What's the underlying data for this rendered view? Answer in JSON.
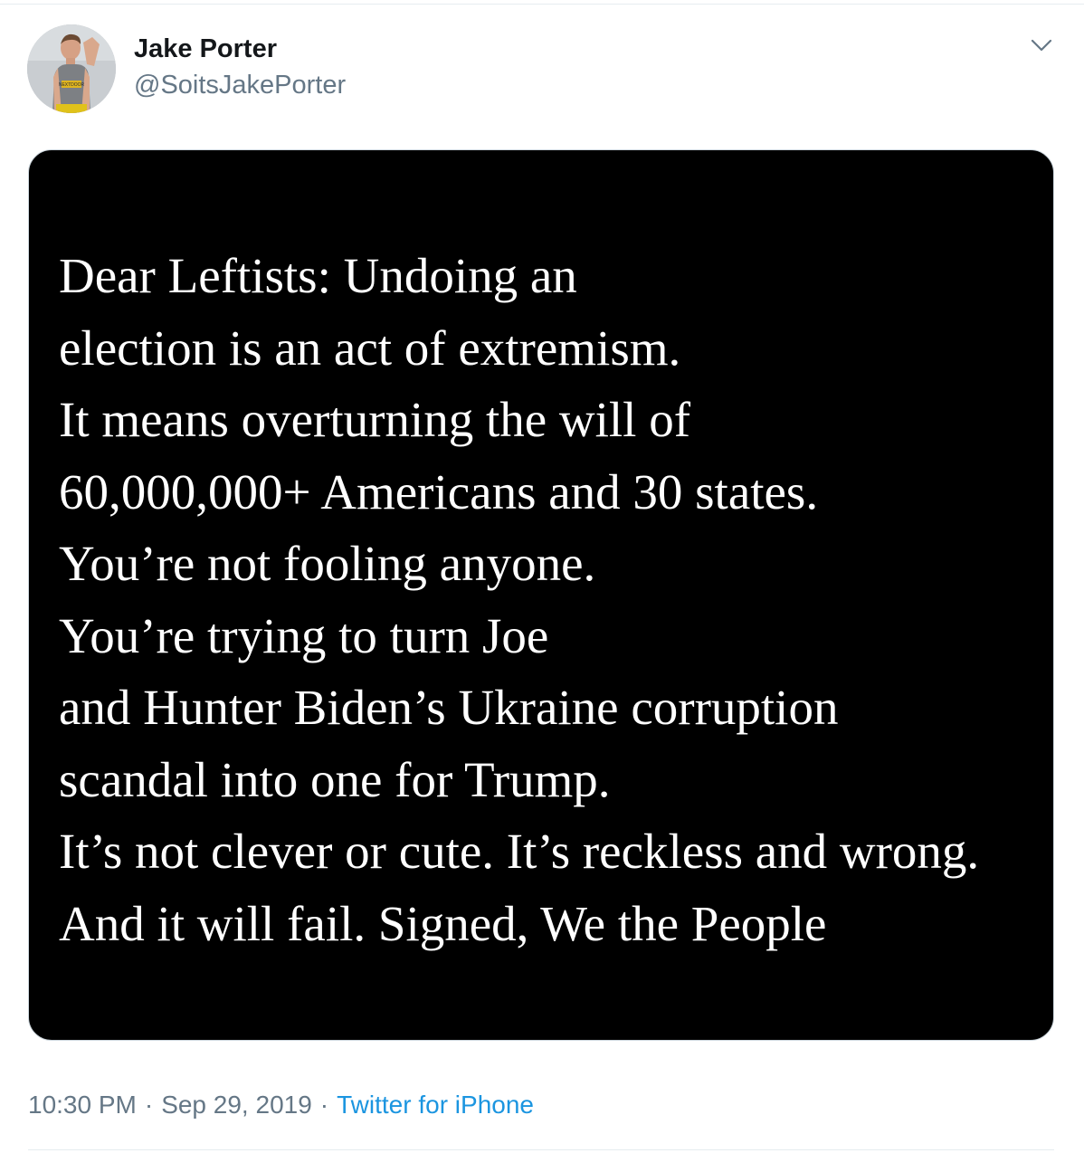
{
  "tweet": {
    "author": {
      "name": "Jake Porter",
      "handle": "@SoitsJakePorter",
      "avatar_icon": "profile-photo",
      "avatar_shirt_text": "NEXTDOOR"
    },
    "menu_icon": "chevron-down-icon",
    "image_text_lines": [
      "Dear Leftists: Undoing an",
      "election is an act of extremism.",
      "It means overturning the will of",
      "60,000,000+ Americans and 30 states.",
      "You’re not fooling anyone.",
      "You’re trying to turn Joe",
      "and Hunter Biden’s Ukraine corruption",
      "scandal into one for Trump.",
      "It’s not clever or cute. It’s reckless and wrong.",
      "And it will fail. Signed, We the People"
    ],
    "time": "10:30 PM",
    "separator": "·",
    "date": "Sep 29, 2019",
    "source": "Twitter for iPhone"
  },
  "colors": {
    "name": "#14171a",
    "secondary_text": "#657786",
    "link": "#1b95e0",
    "media_background": "#000000",
    "media_text": "#ffffff",
    "border": "#e6ecf0"
  }
}
